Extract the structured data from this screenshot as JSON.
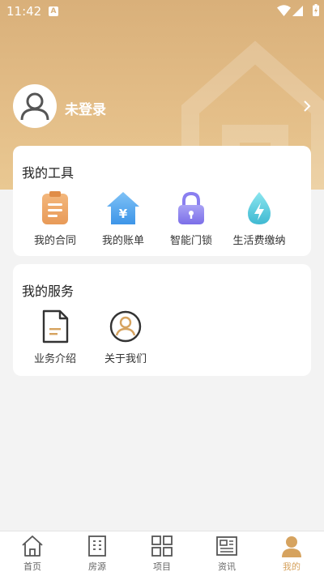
{
  "status_bar": {
    "time": "11:42",
    "notification_badge": "A"
  },
  "profile": {
    "login_status": "未登录"
  },
  "tools": {
    "title": "我的工具",
    "items": [
      {
        "label": "我的合同",
        "icon": "contract-icon"
      },
      {
        "label": "我的账单",
        "icon": "bill-icon"
      },
      {
        "label": "智能门锁",
        "icon": "lock-icon"
      },
      {
        "label": "生活费缴纳",
        "icon": "utility-payment-icon"
      }
    ]
  },
  "services": {
    "title": "我的服务",
    "items": [
      {
        "label": "业务介绍",
        "icon": "document-icon"
      },
      {
        "label": "关于我们",
        "icon": "about-us-icon"
      }
    ]
  },
  "tabbar": {
    "items": [
      {
        "label": "首页",
        "icon": "home-icon"
      },
      {
        "label": "房源",
        "icon": "building-icon"
      },
      {
        "label": "项目",
        "icon": "grid-icon"
      },
      {
        "label": "资讯",
        "icon": "news-icon"
      },
      {
        "label": "我的",
        "icon": "profile-icon"
      }
    ],
    "active_index": 4
  },
  "colors": {
    "accent": "#d6a35f",
    "header": "#e3bd87"
  }
}
